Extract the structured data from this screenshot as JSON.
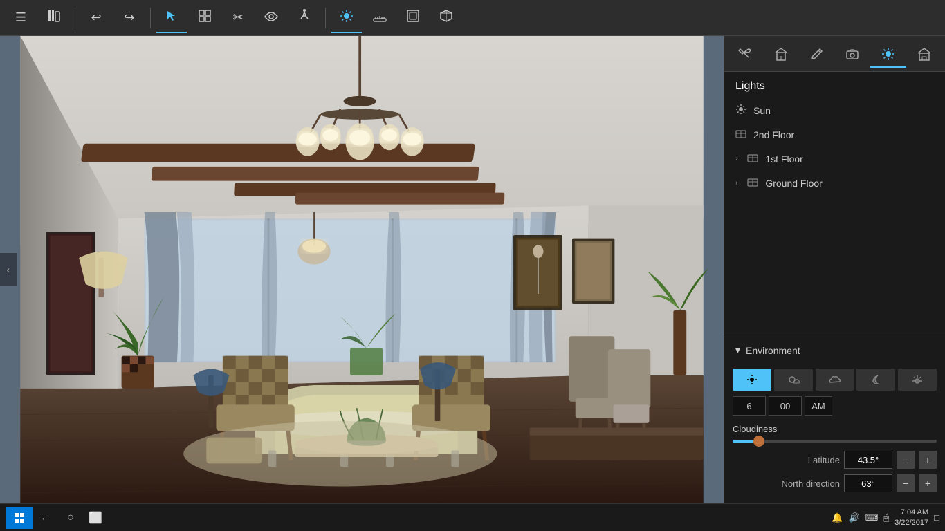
{
  "toolbar": {
    "buttons": [
      {
        "id": "menu",
        "icon": "☰",
        "label": "Menu",
        "active": false
      },
      {
        "id": "library",
        "icon": "📚",
        "label": "Library",
        "active": false
      },
      {
        "id": "undo",
        "icon": "↩",
        "label": "Undo",
        "active": false
      },
      {
        "id": "redo",
        "icon": "↪",
        "label": "Redo",
        "active": false
      },
      {
        "id": "select",
        "icon": "↖",
        "label": "Select",
        "active": true
      },
      {
        "id": "group",
        "icon": "⊞",
        "label": "Group",
        "active": false
      },
      {
        "id": "scissors",
        "icon": "✂",
        "label": "Cut",
        "active": false
      },
      {
        "id": "eye",
        "icon": "👁",
        "label": "View",
        "active": false
      },
      {
        "id": "walk",
        "icon": "🚶",
        "label": "Walk",
        "active": false
      },
      {
        "id": "sun",
        "icon": "☀",
        "label": "Lights",
        "active": true
      },
      {
        "id": "measure",
        "icon": "📐",
        "label": "Measure",
        "active": false
      },
      {
        "id": "frame",
        "icon": "⬜",
        "label": "Frame",
        "active": false
      },
      {
        "id": "cube",
        "icon": "⬡",
        "label": "3D",
        "active": false
      }
    ]
  },
  "right_panel": {
    "icons": [
      {
        "id": "tools",
        "icon": "🔧",
        "label": "Tools",
        "active": false
      },
      {
        "id": "building",
        "icon": "🏛",
        "label": "Building",
        "active": false
      },
      {
        "id": "edit",
        "icon": "✏",
        "label": "Edit",
        "active": false
      },
      {
        "id": "camera",
        "icon": "📷",
        "label": "Camera",
        "active": false
      },
      {
        "id": "lighting",
        "icon": "☀",
        "label": "Lighting",
        "active": true
      },
      {
        "id": "home",
        "icon": "🏠",
        "label": "Home",
        "active": false
      }
    ],
    "lights_header": "Lights",
    "lights": [
      {
        "id": "sun",
        "label": "Sun",
        "icon": "☀",
        "has_chevron": false
      },
      {
        "id": "2nd_floor",
        "label": "2nd Floor",
        "icon": "⊞",
        "has_chevron": false
      },
      {
        "id": "1st_floor",
        "label": "1st Floor",
        "icon": "⊞",
        "has_chevron": true
      },
      {
        "id": "ground_floor",
        "label": "Ground Floor",
        "icon": "⊞",
        "has_chevron": true
      }
    ]
  },
  "environment": {
    "header": "Environment",
    "collapsed": false,
    "time_buttons": [
      {
        "id": "clear",
        "icon": "☀",
        "label": "Clear",
        "active": true
      },
      {
        "id": "cloudy",
        "icon": "⛅",
        "label": "Cloudy",
        "active": false
      },
      {
        "id": "overcast",
        "icon": "☁",
        "label": "Overcast",
        "active": false
      },
      {
        "id": "night",
        "icon": "☽",
        "label": "Night",
        "active": false
      },
      {
        "id": "dawn",
        "icon": "🕐",
        "label": "Dawn",
        "active": false
      }
    ],
    "time_hour": "6",
    "time_minute": "00",
    "time_ampm": "AM",
    "cloudiness_label": "Cloudiness",
    "cloudiness_value": 10,
    "latitude_label": "Latitude",
    "latitude_value": "43.5°",
    "north_direction_label": "North direction",
    "north_direction_value": "63°"
  },
  "taskbar": {
    "time": "7:04 AM",
    "date": "3/22/2017",
    "start_icon": "⊞",
    "nav_back": "←",
    "nav_circle": "○",
    "nav_square": "⬜",
    "icons": [
      "🔔",
      "🔊",
      "⌨",
      "🖱"
    ]
  }
}
